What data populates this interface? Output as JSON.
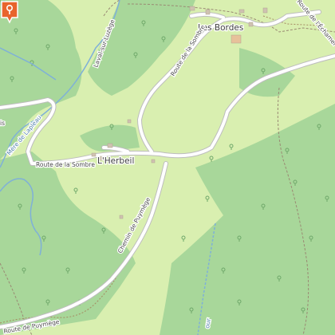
{
  "map": {
    "colors": {
      "meadow": "#d9efb0",
      "forest": "#a8d79a",
      "road": "#ffffff",
      "road_casing": "#bdbdbd",
      "track": "#a58b62",
      "border": "#9a8a73",
      "stream": "#7fb0d8",
      "building": "#cfc2b1",
      "marker": "#e8642c"
    },
    "places": {
      "les_bordes": "Les Bordes",
      "l_herbeil": "L'Herbeil"
    },
    "roads": {
      "route_de_la_sombre_west": "Route de la Sombre",
      "route_de_la_sombre_north": "Route de la Sombre",
      "chemin_de_puymege": "Chemin de Puymège",
      "route_de_lechamel": "Route de l'Échamel",
      "laval_sur_luzege": "Laval-sur-Luzège",
      "puymege_bottom": "Route de Puymège",
      "road_left_edge": "is"
    },
    "waterways": {
      "mere_de_lapleau": "Mère de Lapleau",
      "stream_bottom": "our"
    },
    "icons": {
      "location_marker": "location-pin-icon",
      "viewpoint": "viewpoint-icon"
    }
  }
}
